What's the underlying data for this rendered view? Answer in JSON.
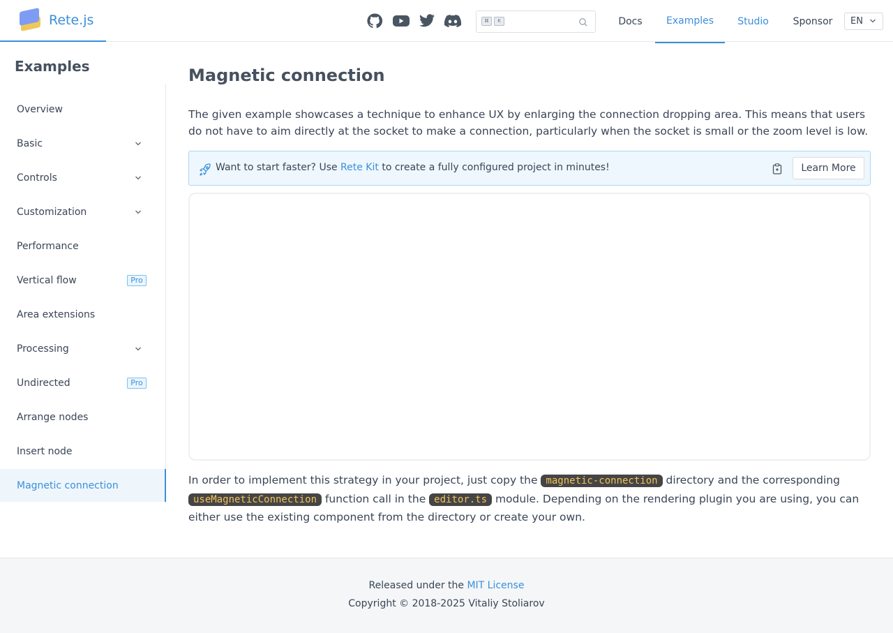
{
  "header": {
    "brand": "Rete.js",
    "search": {
      "kbd_1": "⌘",
      "kbd_2": "K"
    },
    "nav": [
      {
        "label": "Docs"
      },
      {
        "label": "Examples"
      },
      {
        "label": "Studio"
      },
      {
        "label": "Sponsor"
      }
    ],
    "lang": "EN",
    "social_icons": [
      "github-icon",
      "youtube-icon",
      "twitter-icon",
      "discord-icon"
    ]
  },
  "sidebar": {
    "title": "Examples",
    "items": [
      {
        "label": "Overview"
      },
      {
        "label": "Basic"
      },
      {
        "label": "Controls"
      },
      {
        "label": "Customization"
      },
      {
        "label": "Performance"
      },
      {
        "label": "Vertical flow",
        "badge": "Pro"
      },
      {
        "label": "Area extensions"
      },
      {
        "label": "Processing"
      },
      {
        "label": "Undirected",
        "badge": "Pro"
      },
      {
        "label": "Arrange nodes"
      },
      {
        "label": "Insert node"
      },
      {
        "label": "Magnetic connection"
      }
    ]
  },
  "main": {
    "title": "Magnetic connection",
    "intro": "The given example showcases a technique to enhance UX by enlarging the connection dropping area. This means that users do not have to aim directly at the socket to make a connection, particularly when the socket is small or the zoom level is low.",
    "banner": {
      "pre": "Want to start faster? Use ",
      "link": "Rete Kit",
      "post": " to create a fully configured project in minutes!",
      "button": "Learn More"
    },
    "outro": {
      "t1": "In order to implement this strategy in your project, just copy the ",
      "c1": "magnetic-connection",
      "t2": " directory and the corresponding ",
      "c2": "useMagneticConnection",
      "t3": " function call in the ",
      "c3": "editor.ts",
      "t4": " module. Depending on the rendering plugin you are using, you can either use the existing component from the directory or create your own."
    }
  },
  "footer": {
    "pre": "Released under the ",
    "license": "MIT License",
    "copyright": "Copyright © 2018-2025 Vitaliy Stoliarov"
  },
  "colors": {
    "accent": "#3b8fdb",
    "code_bg": "#454545",
    "code_fg": "#f3c25b"
  }
}
